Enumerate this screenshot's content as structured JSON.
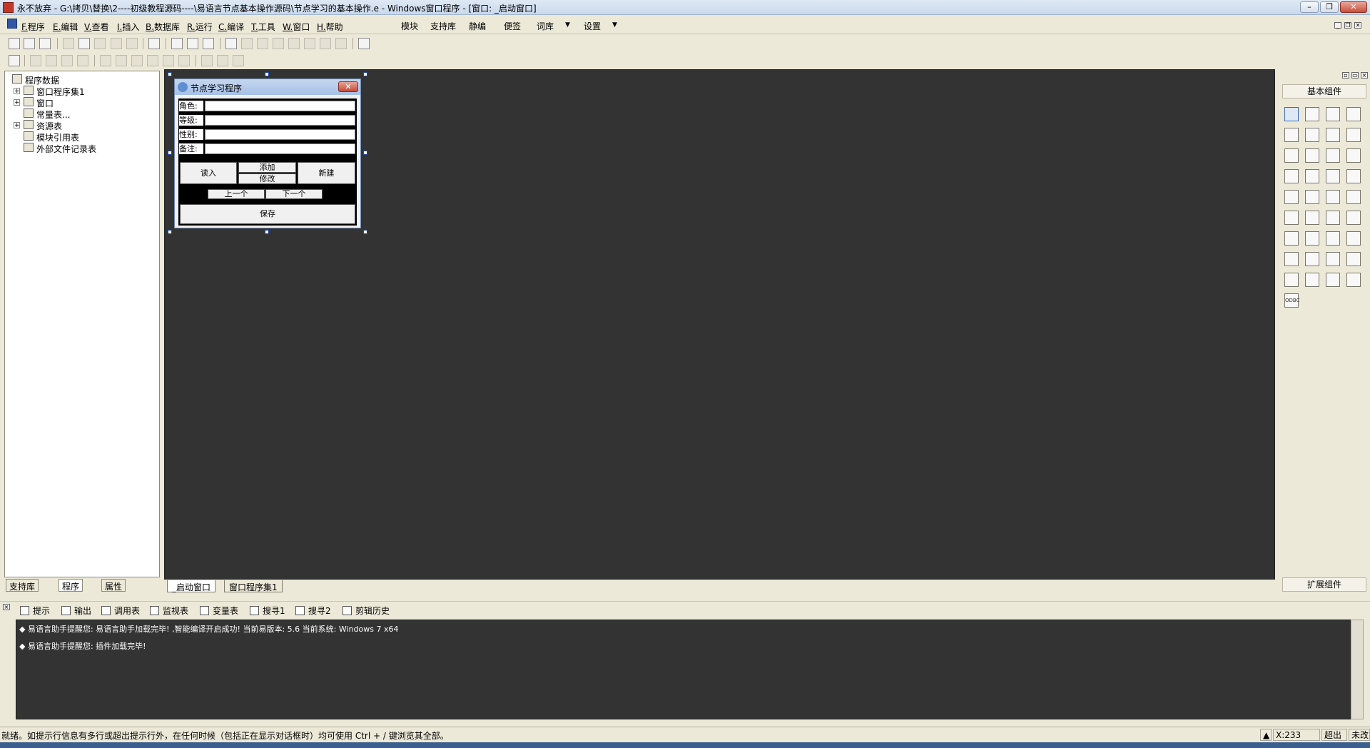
{
  "window": {
    "title": "永不放弃 - G:\\拷贝\\替换\\2----初级教程源码----\\易语言节点基本操作源码\\节点学习的基本操作.e - Windows窗口程序 - [窗口: _启动窗口]",
    "min_btn": "–",
    "restore_btn": "❐",
    "close_btn": "✕",
    "doc_min_btn": "_",
    "doc_restore_btn": "❐",
    "doc_close_btn": "✕"
  },
  "menu": {
    "items": [
      {
        "key": "F.",
        "label": "程序"
      },
      {
        "key": "E.",
        "label": "编辑"
      },
      {
        "key": "V.",
        "label": "查看"
      },
      {
        "key": "I.",
        "label": "插入"
      },
      {
        "key": "B.",
        "label": "数据库"
      },
      {
        "key": "R.",
        "label": "运行"
      },
      {
        "key": "C.",
        "label": "编译"
      },
      {
        "key": "T.",
        "label": "工具"
      },
      {
        "key": "W.",
        "label": "窗口"
      },
      {
        "key": "H.",
        "label": "帮助"
      }
    ],
    "extras": [
      "模块",
      "支持库",
      "静编",
      "便签",
      "词库",
      "设置"
    ]
  },
  "left_panel": {
    "tree": [
      {
        "label": "程序数据",
        "level": 0
      },
      {
        "label": "窗口程序集1",
        "level": 1,
        "expand": "+"
      },
      {
        "label": "窗口",
        "level": 1,
        "expand": "+"
      },
      {
        "label": "常量表...",
        "level": 1
      },
      {
        "label": "资源表",
        "level": 1,
        "expand": "+"
      },
      {
        "label": "模块引用表",
        "level": 1
      },
      {
        "label": "外部文件记录表",
        "level": 1
      }
    ],
    "tabs": [
      "支持库",
      "程序",
      "属性"
    ]
  },
  "form": {
    "title": "节点学习程序",
    "close": "✕",
    "labels": [
      "角色:",
      "等级:",
      "性别:",
      "备注:"
    ],
    "buttons": {
      "read": "读入",
      "add": "添加",
      "modify": "修改",
      "new": "新建",
      "prev": "上一个",
      "next": "下一个",
      "save": "保存"
    }
  },
  "design_tabs": [
    "_启动窗口",
    "窗口程序集1"
  ],
  "right_panel": {
    "header": "基本组件",
    "footer": "扩展组件",
    "odbc_label": "ODBC"
  },
  "output_tabs": [
    "提示",
    "输出",
    "调用表",
    "监视表",
    "变量表",
    "搜寻1",
    "搜寻2",
    "剪辑历史"
  ],
  "output_lines": [
    "◆ 易语言助手提醒您: 易语言助手加载完毕! ,智能编译开启成功! 当前易版本: 5.6 当前系统: Windows 7 x64",
    "◆ 易语言助手提醒您: 插件加载完毕!"
  ],
  "status": {
    "message": "就绪。如提示行信息有多行或超出提示行外，在任何时候（包括正在显示对话框时）均可使用 Ctrl + / 键浏览其全部。",
    "coord": "X:233",
    "mode": "超出",
    "state": "未改"
  }
}
